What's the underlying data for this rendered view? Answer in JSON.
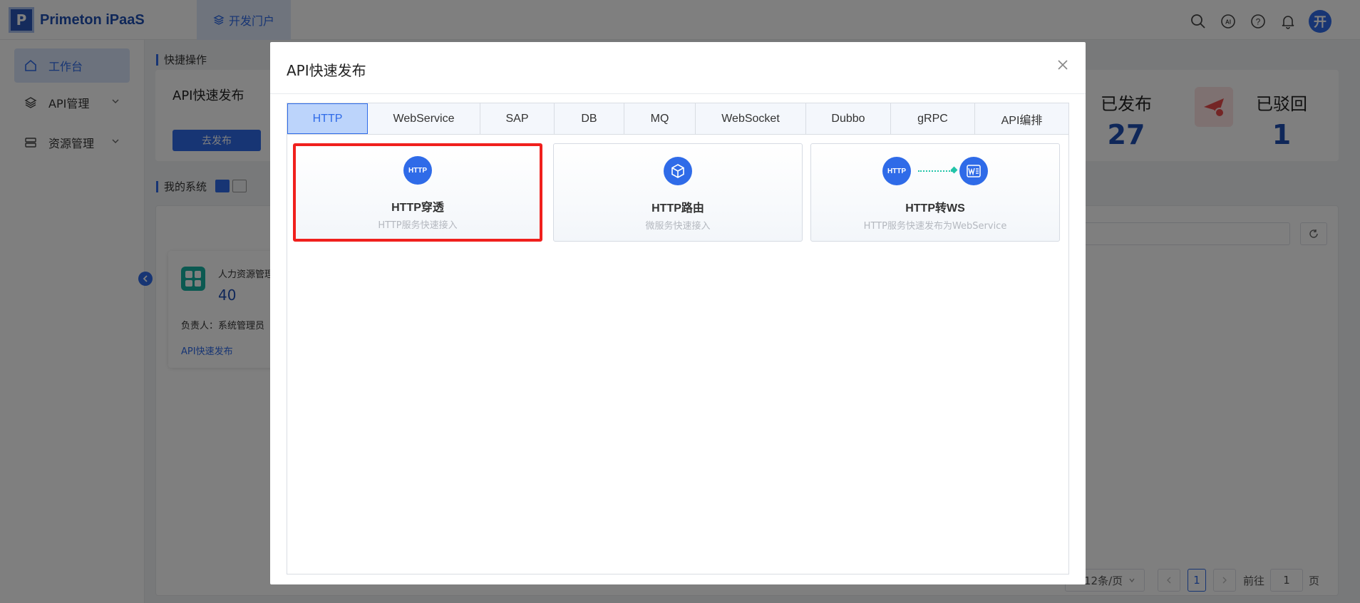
{
  "app": {
    "logo_text": "Primeton iPaaS",
    "portal_tab": "开发门户",
    "avatar": "开"
  },
  "sidebar": {
    "items": [
      {
        "label": "工作台"
      },
      {
        "label": "API管理"
      },
      {
        "label": "资源管理"
      }
    ]
  },
  "dashboard": {
    "quick_ops_title": "快捷操作",
    "quick_card_title": "API快速发布",
    "go_publish": "去发布",
    "stats": [
      {
        "label": "已发布",
        "value": "27"
      },
      {
        "label": "已驳回",
        "value": "1"
      }
    ],
    "my_systems_title": "我的系统",
    "system_card": {
      "name": "人力资源管理",
      "count": "40",
      "owner": "负责人：系统管理员",
      "link": "API快速发布"
    },
    "pagination": {
      "page_size": "12条/页",
      "current_page": "1",
      "goto_prefix": "前往",
      "goto_value": "1",
      "goto_suffix": "页"
    }
  },
  "modal": {
    "title": "API快速发布",
    "tabs": [
      "HTTP",
      "WebService",
      "SAP",
      "DB",
      "MQ",
      "WebSocket",
      "Dubbo",
      "gRPC",
      "API编排"
    ],
    "active_tab": "HTTP",
    "options": [
      {
        "title": "HTTP穿透",
        "desc": "HTTP服务快速接入",
        "icon_text": "HTTP"
      },
      {
        "title": "HTTP路由",
        "desc": "微服务快速接入"
      },
      {
        "title": "HTTP转WS",
        "desc": "HTTP服务快速发布为WebService",
        "icon_text": "HTTP"
      }
    ]
  }
}
